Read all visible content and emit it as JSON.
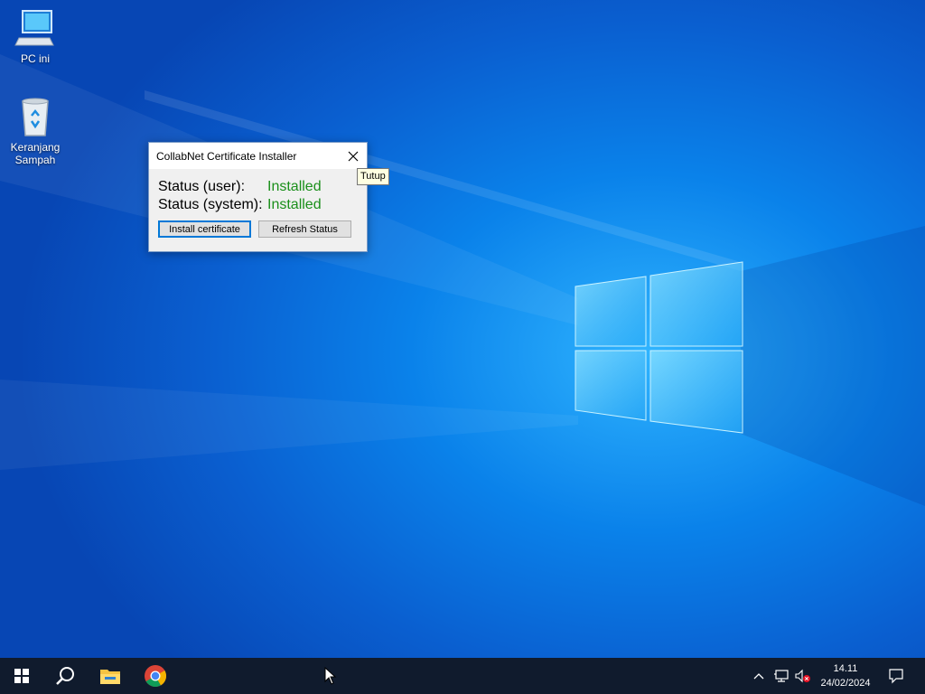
{
  "desktop": {
    "icons": [
      {
        "label": "PC ini",
        "icon": "computer-icon"
      },
      {
        "label": "Keranjang Sampah",
        "label_line1": "Keranjang",
        "label_line2": "Sampah",
        "icon": "recycle-bin-icon"
      }
    ]
  },
  "dialog": {
    "title": "CollabNet Certificate Installer",
    "status_user_label": "Status (user):",
    "status_user_value": "Installed",
    "status_system_label": "Status (system):",
    "status_system_value": "Installed",
    "install_button": "Install certificate",
    "refresh_button": "Refresh Status",
    "close_tooltip": "Tutup"
  },
  "taskbar": {
    "items": [
      "windows-start-icon",
      "search-icon",
      "file-explorer-icon",
      "chrome-icon"
    ],
    "tray": [
      "chevron-up-icon",
      "network-icon",
      "volume-muted-icon",
      "notification-icon"
    ],
    "time": "14.11",
    "date": "24/02/2024"
  },
  "colors": {
    "status_ok": "#1a8f1a",
    "taskbar": "#101b2d",
    "accent": "#0078d7"
  }
}
